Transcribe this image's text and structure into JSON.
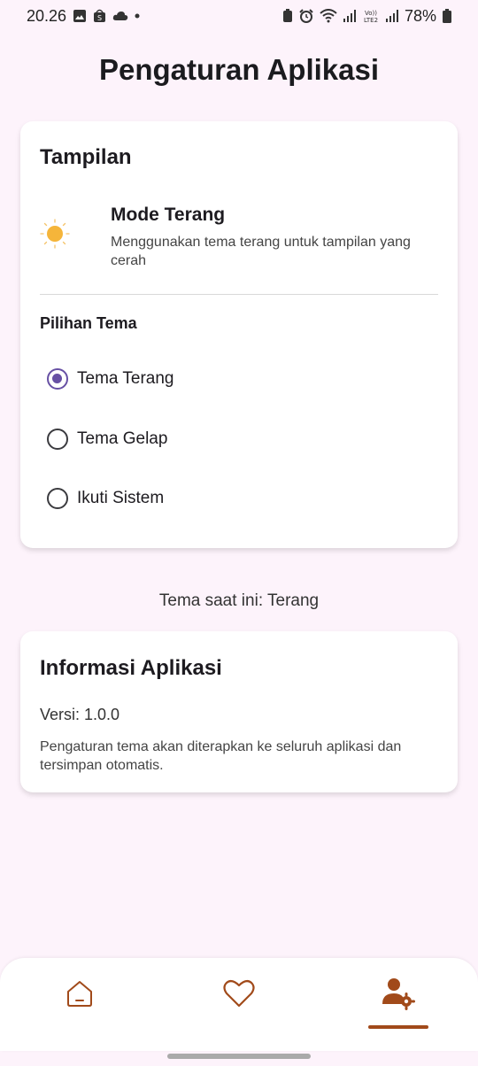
{
  "status_bar": {
    "time": "20.26",
    "battery": "78%"
  },
  "page": {
    "title": "Pengaturan Aplikasi"
  },
  "display_card": {
    "title": "Tampilan",
    "mode": {
      "title": "Mode Terang",
      "description": "Menggunakan tema terang untuk tampilan yang cerah",
      "icon": "sun-icon"
    },
    "theme_section_label": "Pilihan Tema",
    "options": [
      {
        "label": "Tema Terang",
        "selected": true
      },
      {
        "label": "Tema Gelap",
        "selected": false
      },
      {
        "label": "Ikuti Sistem",
        "selected": false
      }
    ]
  },
  "current_theme": "Tema saat ini: Terang",
  "info_card": {
    "title": "Informasi Aplikasi",
    "version": "Versi: 1.0.0",
    "description": "Pengaturan tema akan diterapkan ke seluruh aplikasi dan tersimpan otomatis."
  },
  "bottom_nav": {
    "items": [
      {
        "icon": "home-icon",
        "active": false
      },
      {
        "icon": "heart-icon",
        "active": false
      },
      {
        "icon": "user-settings-icon",
        "active": true
      }
    ],
    "accent_color": "#a14a1a"
  },
  "colors": {
    "primary": "#6750a4",
    "background": "#fdf3fb",
    "nav_accent": "#a14a1a"
  }
}
